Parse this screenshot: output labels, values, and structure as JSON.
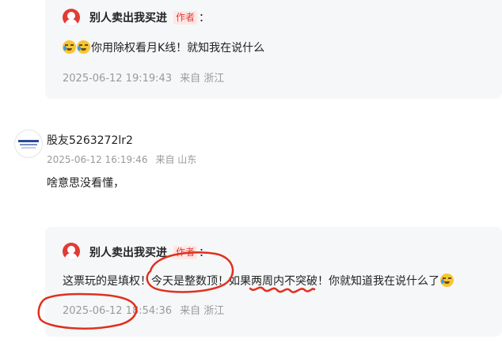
{
  "top_reply": {
    "author": "别人卖出我买进",
    "badge": "作者",
    "colon": "：",
    "emojis": [
      "laugh-cry-emoji",
      "laugh-cry-emoji"
    ],
    "content": "你用除权看月K线！就知我在说什么",
    "time": "2025-06-12 19:19:43",
    "location": "来自 浙江"
  },
  "comment": {
    "user": "股友5263272lr2",
    "time": "2025-06-12 16:19:46",
    "location": "来自 山东",
    "content": "啥意思没看懂，"
  },
  "bottom_reply": {
    "author": "别人卖出我买进",
    "badge": "作者",
    "colon": "：",
    "content": "这票玩的是填权！今天是整数顶！如果两周内不突破！你就知道我在说什么了",
    "emoji": "laugh-cry-emoji",
    "time": "2025-06-12 18:54:36",
    "location": "来自 浙江"
  },
  "annotation_color": "#e0301e"
}
